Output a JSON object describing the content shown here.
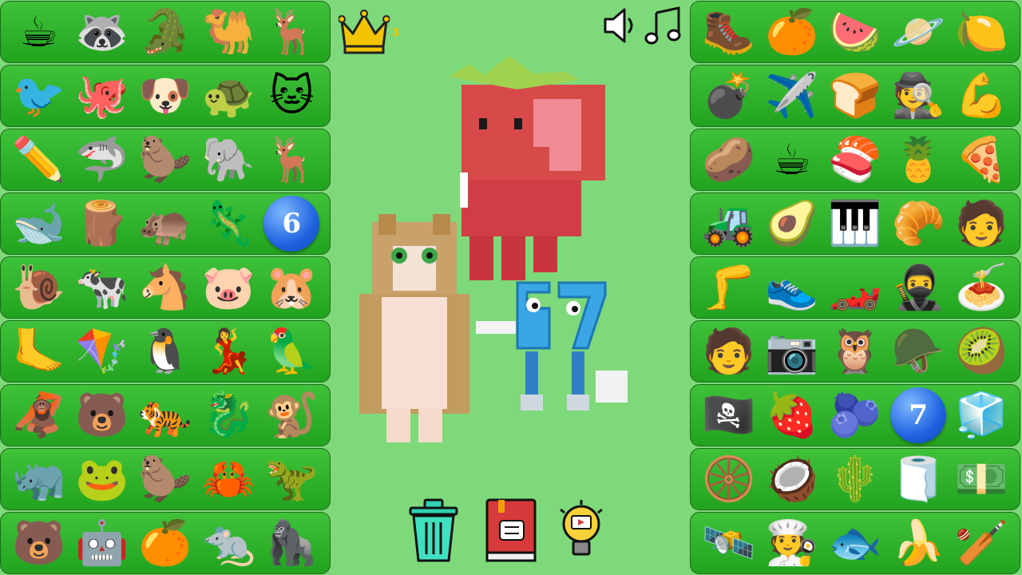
{
  "score": {
    "count": "3"
  },
  "left_rows": [
    [
      "☕",
      "🦝",
      "🐊",
      "🐫",
      "🦌"
    ],
    [
      "🐦",
      "🐙",
      "🐶",
      "🐢",
      "🐱"
    ],
    [
      "✏️",
      "🦈",
      "🦫",
      "🐘",
      "🦌"
    ],
    [
      "🐋",
      "🪵",
      "🦛",
      "🦎",
      "6"
    ],
    [
      "🐌",
      "🐄",
      "🐴",
      "🐷",
      "🐹"
    ],
    [
      "🦶",
      "🪁",
      "🐧",
      "💃",
      "🦜"
    ],
    [
      "🦧",
      "🐻",
      "🐅",
      "🐉",
      "🐒"
    ],
    [
      "🦏",
      "🐸",
      "🦫",
      "🦀",
      "🦖"
    ],
    [
      "🐻",
      "🤖",
      "🍊",
      "🐀",
      "🦍"
    ]
  ],
  "right_rows": [
    [
      "🥾",
      "🍊",
      "🍉",
      "🪐",
      "🍋"
    ],
    [
      "💣",
      "✈️",
      "🍞",
      "🕵️",
      "💪"
    ],
    [
      "🥔",
      "☕",
      "🍣",
      "🍍",
      "🍕"
    ],
    [
      "🚜",
      "🥑",
      "🎹",
      "🥐",
      "🧑"
    ],
    [
      "🦵",
      "👟",
      "🏎️",
      "🥷",
      "🍝"
    ],
    [
      "🧑",
      "📷",
      "🦉",
      "🪖",
      "🥝"
    ],
    [
      "🏴‍☠️",
      "🍓",
      "🫐",
      "7",
      "🧊"
    ],
    [
      "🛞",
      "🥥",
      "🌵",
      "🧻",
      "💵"
    ],
    [
      "🛰️",
      "🧑‍🍳",
      "🐟",
      "🍌",
      "🏏"
    ]
  ],
  "colors": {
    "background": "#7ed97a",
    "row_top": "#3fc23a",
    "row_bottom": "#22a31f",
    "crown": "#f2c500"
  }
}
